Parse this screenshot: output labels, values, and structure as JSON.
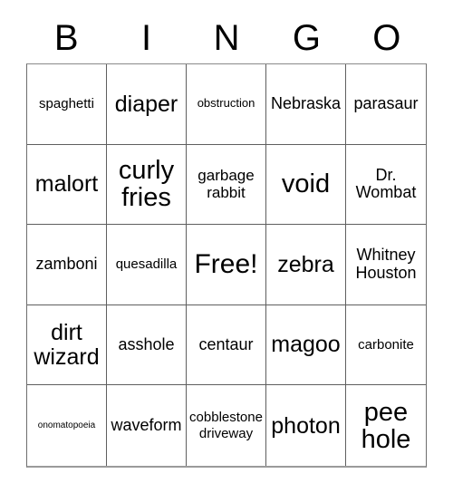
{
  "card": {
    "header_letters": [
      "B",
      "I",
      "N",
      "G",
      "O"
    ],
    "rows": [
      [
        {
          "text": "spaghetti",
          "size": "s"
        },
        {
          "text": "diaper",
          "size": "xl"
        },
        {
          "text": "obstruction",
          "size": "xs"
        },
        {
          "text": "Nebraska",
          "size": "ml"
        },
        {
          "text": "parasaur",
          "size": "ml"
        }
      ],
      [
        {
          "text": "malort",
          "size": "xl"
        },
        {
          "text": "curly\nfries",
          "size": "xxl"
        },
        {
          "text": "garbage\nrabbit",
          "size": "m"
        },
        {
          "text": "void",
          "size": "xxl"
        },
        {
          "text": "Dr.\nWombat",
          "size": "ml"
        }
      ],
      [
        {
          "text": "zamboni",
          "size": "ml"
        },
        {
          "text": "quesadilla",
          "size": "s"
        },
        {
          "text": "Free!",
          "size": "free"
        },
        {
          "text": "zebra",
          "size": "xl"
        },
        {
          "text": "Whitney\nHouston",
          "size": "ml"
        }
      ],
      [
        {
          "text": "dirt\nwizard",
          "size": "xl"
        },
        {
          "text": "asshole",
          "size": "ml"
        },
        {
          "text": "centaur",
          "size": "ml"
        },
        {
          "text": "magoo",
          "size": "xl"
        },
        {
          "text": "carbonite",
          "size": "s"
        }
      ],
      [
        {
          "text": "onomatopoeia",
          "size": "xxs"
        },
        {
          "text": "waveform",
          "size": "ml"
        },
        {
          "text": "cobblestone\ndriveway",
          "size": "s"
        },
        {
          "text": "photon",
          "size": "xl"
        },
        {
          "text": "pee\nhole",
          "size": "xxl"
        }
      ]
    ]
  }
}
